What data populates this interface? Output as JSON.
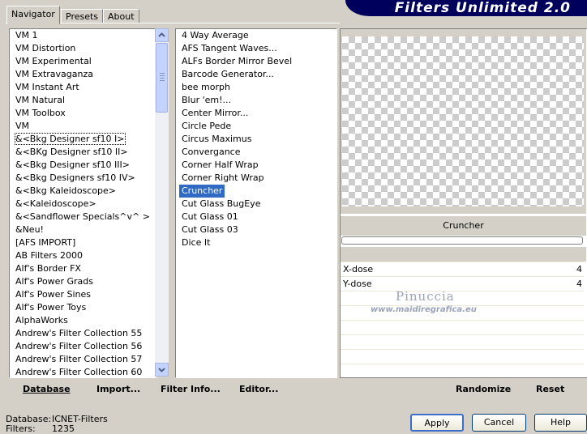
{
  "tabs": [
    "Navigator",
    "Presets",
    "About"
  ],
  "banner": "Filters Unlimited 2.0",
  "categories": [
    "VM 1",
    "VM Distortion",
    "VM Experimental",
    "VM Extravaganza",
    "VM Instant Art",
    "VM Natural",
    "VM Toolbox",
    "VM",
    "&<Bkg Designer sf10 I>",
    "&<BKg Designer sf10 II>",
    "&<Bkg Designer sf10 III>",
    "&<Bkg Designers sf10 IV>",
    "&<Bkg Kaleidoscope>",
    "&<Kaleidoscope>",
    "&<Sandflower Specials^v^ >",
    "&Neu!",
    "[AFS IMPORT]",
    "AB Filters 2000",
    "Alf's Border FX",
    "Alf's Power Grads",
    "Alf's Power Sines",
    "Alf's Power Toys",
    "AlphaWorks",
    "Andrew's Filter Collection 55",
    "Andrew's Filter Collection 56",
    "Andrew's Filter Collection 57",
    "Andrew's Filter Collection 60"
  ],
  "filters": [
    "4 Way Average",
    "AFS Tangent Waves...",
    "ALFs Border Mirror Bevel",
    "Barcode Generator...",
    "bee morph",
    "Blur 'em!...",
    "Center Mirror...",
    "Circle Pede",
    "Circus Maximus",
    "Convergance",
    "Corner Half Wrap",
    "Corner Right Wrap",
    "Cruncher",
    "Cut Glass  BugEye",
    "Cut Glass 01",
    "Cut Glass 03",
    "Dice It"
  ],
  "selected_filter": "Cruncher",
  "params": [
    {
      "label": "X-dose",
      "value": "4"
    },
    {
      "label": "Y-dose",
      "value": "4"
    }
  ],
  "watermark": {
    "name": "Pinuccia",
    "url": "www.maidiregrafica.eu"
  },
  "toolbar": {
    "database": "Database",
    "import": "Import...",
    "filter_info": "Filter Info...",
    "editor": "Editor...",
    "randomize": "Randomize",
    "reset": "Reset"
  },
  "status": {
    "database_label": "Database:",
    "database_value": "ICNET-Filters",
    "filters_label": "Filters:",
    "filters_value": "1235"
  },
  "buttons": {
    "apply": "Apply",
    "cancel": "Cancel",
    "help": "Help"
  },
  "colors": {
    "selection": "#316ac5",
    "banner": "#00005c"
  }
}
